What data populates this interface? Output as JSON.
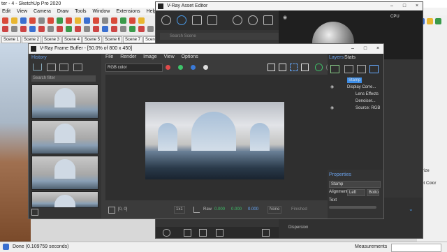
{
  "sketchup": {
    "title": "ter - 4 - SketchUp Pro 2020",
    "menu": [
      "Edit",
      "View",
      "Camera",
      "Draw",
      "Tools",
      "Window",
      "Extensions",
      "Help"
    ],
    "scenes": [
      "Scene 1",
      "Scene 2",
      "Scene 3",
      "Scene 4",
      "Scene 5",
      "Scene 6",
      "Scene 7",
      "Scene 8"
    ],
    "partial_scene_label": "Scene",
    "status": "Done (0.109759 seconds)",
    "measurements_label": "Measurements",
    "right_labels": [
      "olorize",
      "eset Color"
    ]
  },
  "asset_editor": {
    "title": "V-Ray Asset Editor",
    "search_placeholder": "Search Scene",
    "cpu_label": "CPU",
    "bottom_label": "Dispersion"
  },
  "frame_buffer": {
    "title": "V-Ray Frame Buffer - [50.0% of 800 x 450]",
    "history_label": "History",
    "history_search_placeholder": "Search filter",
    "menu": [
      "File",
      "Render",
      "Image",
      "View",
      "Options"
    ],
    "channel_select": "RGB color",
    "coords": "[0, 0]",
    "zoom": "1x1",
    "raw_label": "Raw",
    "raw_values": [
      "0.000",
      "0.000",
      "0.000"
    ],
    "color_mode": "None",
    "pixel_status": "Finished",
    "layers_tab": "Layers",
    "stats_tab": "Stats",
    "layers": [
      "Stamp",
      "Display Corre...",
      "Lens Effects",
      "Denoiser...",
      "Source: RGB"
    ],
    "properties_label": "Properties",
    "stamp_field": "Stamp",
    "alignment_label": "Alignment",
    "alignment_value": "Left",
    "bottom_value": "Botto",
    "text_label": "Text"
  },
  "colors": {
    "accent": "#3d8ee8",
    "red_dot": "#e04a4a",
    "green_dot": "#3ec46a",
    "blue_dot": "#3a7ad8"
  }
}
